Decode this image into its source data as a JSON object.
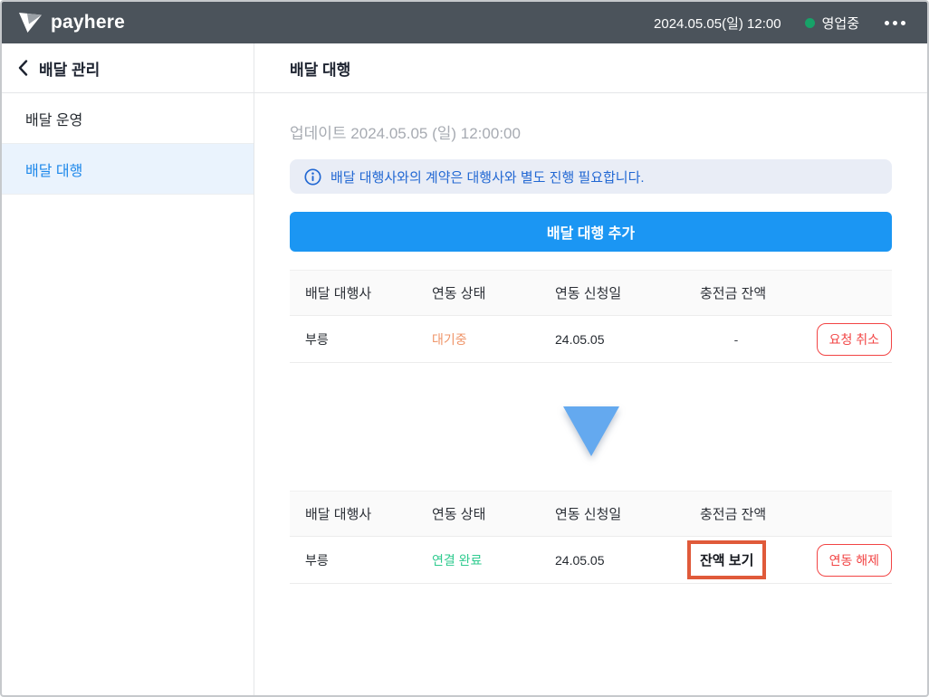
{
  "topbar": {
    "brand": "payhere",
    "datetime": "2024.05.05(일) 12:00",
    "status_label": "영업중",
    "status_dot_color": "#17a268",
    "bg_color": "#4b535b"
  },
  "sidebar": {
    "title": "배달 관리",
    "items": [
      {
        "label": "배달 운영",
        "active": false
      },
      {
        "label": "배달 대행",
        "active": true
      }
    ],
    "active_color": "#1d88ea",
    "active_bg": "#eaf3fd"
  },
  "main": {
    "title": "배달 대행",
    "updated_text": "업데이트 2024.05.05 (일) 12:00:00",
    "notice": "배달 대행사와의 계약은 대행사와 별도 진행 필요합니다.",
    "notice_color": "#2268d3",
    "add_button_label": "배달 대행 추가",
    "add_button_color": "#1b96f3",
    "tables": [
      {
        "headers": [
          "배달 대행사",
          "연동 상태",
          "연동 신청일",
          "충전금 잔액"
        ],
        "row": {
          "agency": "부릉",
          "status": "대기중",
          "status_color": "#ef9468",
          "request_date": "24.05.05",
          "balance": "-",
          "action_label": "요청 취소"
        }
      },
      {
        "headers": [
          "배달 대행사",
          "연동 상태",
          "연동 신청일",
          "충전금 잔액"
        ],
        "row": {
          "agency": "부릉",
          "status": "연결 완료",
          "status_color": "#2fcb8f",
          "request_date": "24.05.05",
          "balance": "잔액 보기",
          "balance_highlight_color": "#e05a3a",
          "action_label": "연동 해제"
        }
      }
    ],
    "action_button_color": "#f24444",
    "arrow_color": "#64a9ef"
  }
}
